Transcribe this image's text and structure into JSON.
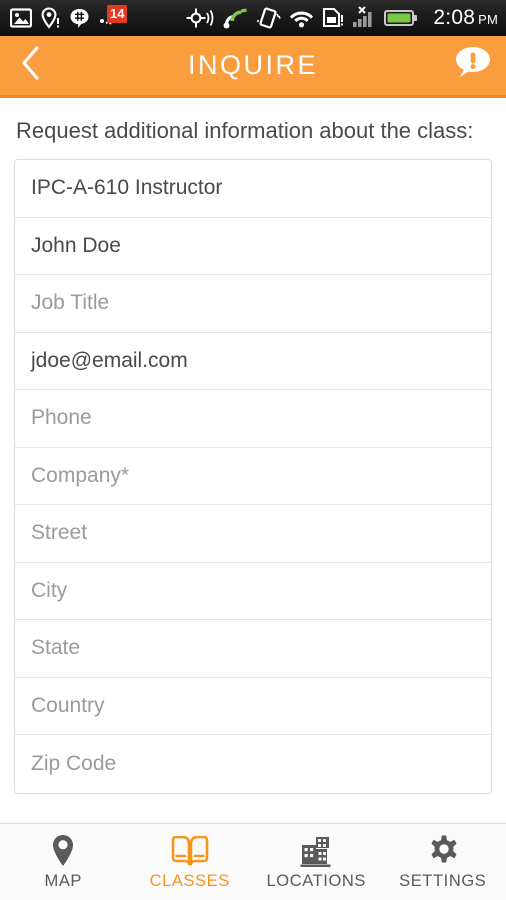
{
  "statusbar": {
    "left_icons": [
      {
        "name": "photo-icon"
      },
      {
        "name": "location-pin-alert-icon"
      },
      {
        "name": "hangouts-icon"
      },
      {
        "name": "notification-badge-icon",
        "badge": "14"
      }
    ],
    "right_icons": [
      {
        "name": "gps-crosshair-icon"
      },
      {
        "name": "satellite-signal-icon"
      },
      {
        "name": "vibrate-icon"
      },
      {
        "name": "wifi-icon"
      },
      {
        "name": "sim-card-alert-icon"
      },
      {
        "name": "cell-signal-no-service-icon"
      },
      {
        "name": "battery-icon"
      }
    ],
    "time": "2:08",
    "ampm": "PM"
  },
  "header": {
    "back_icon": "chevron-left-icon",
    "title": "INQUIRE",
    "info_icon": "speech-bubble-alert-icon",
    "background": "#fa9d3e",
    "underline": "#f08a22"
  },
  "main": {
    "intro": "Request additional information about the class:",
    "fields": [
      {
        "name": "instructor-field",
        "text": "IPC-A-610 Instructor",
        "filled": true
      },
      {
        "name": "name-field",
        "text": "John Doe",
        "filled": true
      },
      {
        "name": "job-title-field",
        "text": "Job Title",
        "filled": false
      },
      {
        "name": "email-field",
        "text": "jdoe@email.com",
        "filled": true
      },
      {
        "name": "phone-field",
        "text": "Phone",
        "filled": false
      },
      {
        "name": "company-field",
        "text": "Company*",
        "filled": false
      },
      {
        "name": "street-field",
        "text": "Street",
        "filled": false
      },
      {
        "name": "city-field",
        "text": "City",
        "filled": false
      },
      {
        "name": "state-field",
        "text": "State",
        "filled": false
      },
      {
        "name": "country-field",
        "text": "Country",
        "filled": false
      },
      {
        "name": "zip-code-field",
        "text": "Zip Code",
        "filled": false
      }
    ]
  },
  "bottomnav": {
    "active_color": "#f7941e",
    "inactive_color": "#5a5a5a",
    "items": [
      {
        "name": "map",
        "label": "MAP",
        "icon": "map-pin-icon",
        "active": false
      },
      {
        "name": "classes",
        "label": "CLASSES",
        "icon": "book-icon",
        "active": true
      },
      {
        "name": "locations",
        "label": "LOCATIONS",
        "icon": "buildings-icon",
        "active": false
      },
      {
        "name": "settings",
        "label": "SETTINGS",
        "icon": "gear-icon",
        "active": false
      }
    ]
  }
}
